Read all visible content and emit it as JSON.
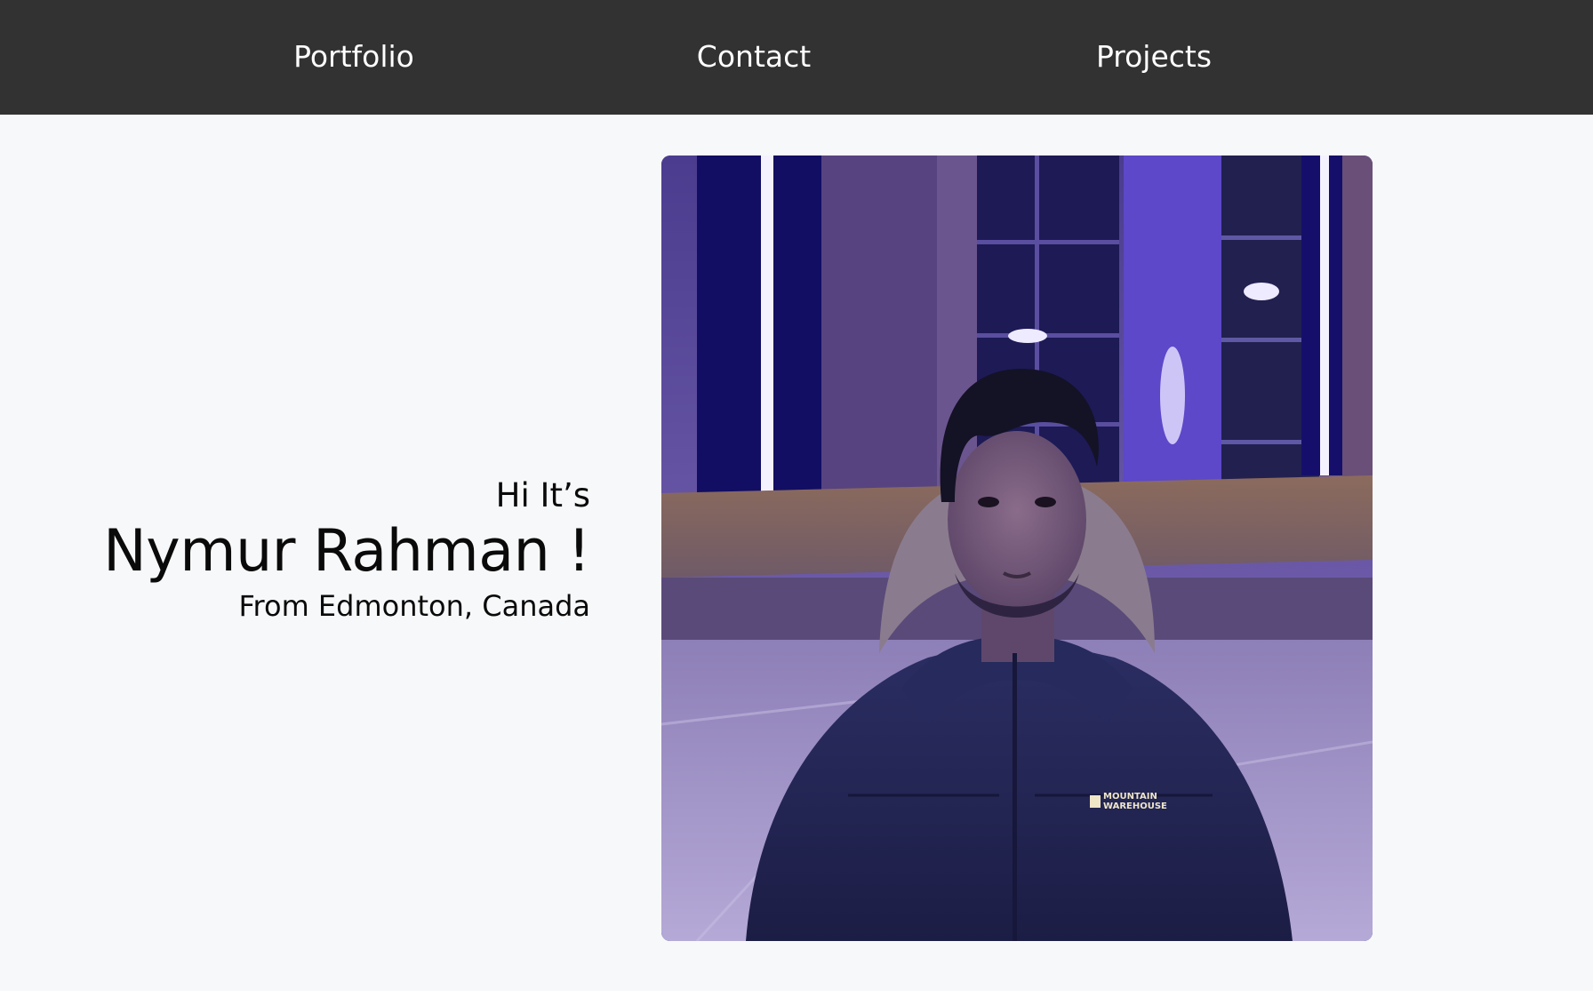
{
  "nav": {
    "items": [
      {
        "label": "Portfolio"
      },
      {
        "label": "Contact"
      },
      {
        "label": "Projects"
      }
    ]
  },
  "hero": {
    "greeting": "Hi It’s",
    "name": "Nymur Rahman !",
    "location": "From Edmonton, Canada",
    "photo": {
      "jacket_text_line1": "MOUNTAIN",
      "jacket_text_line2": "WAREHOUSE"
    }
  },
  "colors": {
    "navbar_bg": "#323232",
    "nav_text": "#ffffff",
    "page_bg": "#f7f8f9",
    "hero_text": "#0a0a0a"
  }
}
